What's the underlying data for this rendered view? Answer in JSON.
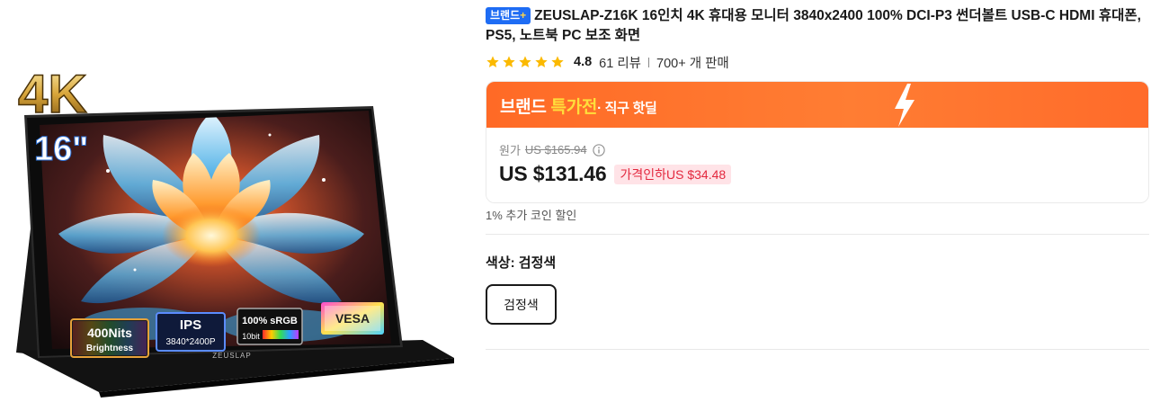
{
  "product": {
    "brand_badge": "브랜드",
    "brand_badge_plus": "+",
    "title": "ZEUSLAP-Z16K 16인치 4K 휴대용 모니터 3840x2400 100% DCI-P3 썬더볼트 USB-C HDMI 휴대폰, PS5, 노트북 PC 보조 화면",
    "image_alt": "ZEUSLAP 16인치 4K 휴대용 모니터"
  },
  "image_text": {
    "resolution": "4K",
    "size": "16\"",
    "brand": "ZEUSLAP",
    "badges": [
      {
        "line1": "400Nits",
        "line2": "Brightness"
      },
      {
        "line1": "IPS",
        "line2": "3840*2400P"
      },
      {
        "line1": "100% sRGB",
        "line2": "10bit"
      },
      {
        "line1": "VESA",
        "line2": ""
      }
    ]
  },
  "rating": {
    "stars": 5,
    "value": "4.8",
    "reviews": "61 리뷰",
    "sold": "700+ 개 판매"
  },
  "promo": {
    "part1": "브랜드 ",
    "part2": "특가전",
    "part3": "· 직구 핫딜"
  },
  "price": {
    "original_label": "원가",
    "original": "US $165.94",
    "sale": "US $131.46",
    "discount": "가격인하US $34.48"
  },
  "coin_text": "1% 추가 코인 할인",
  "color": {
    "title": "색상: 검정색",
    "selected": "검정색"
  },
  "colors": {
    "brand_blue": "#1e6cf4",
    "promo_orange": "#ff6a26",
    "promo_yellow": "#ffde3b",
    "star": "#fbb900",
    "discount_red": "#e3283e",
    "discount_bg": "#ffe3e7"
  },
  "icons": [
    "star-icon",
    "info-icon",
    "lightning-icon"
  ]
}
